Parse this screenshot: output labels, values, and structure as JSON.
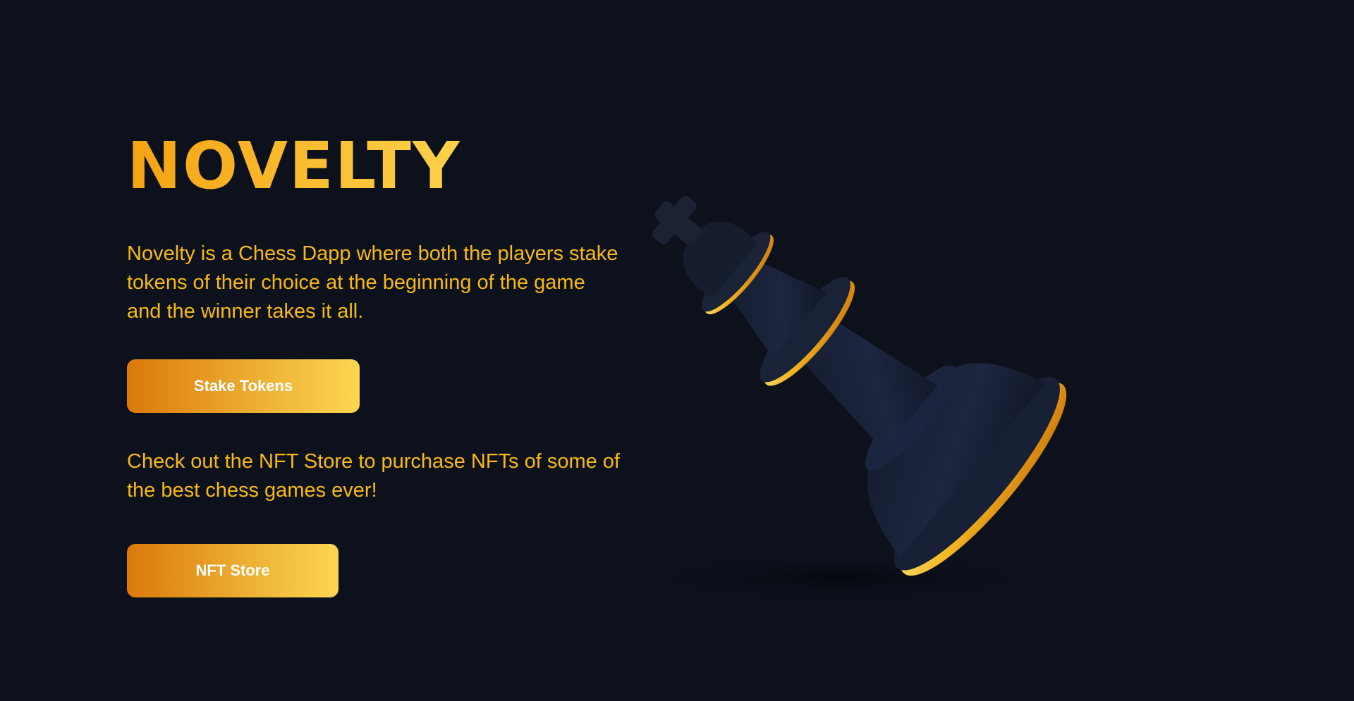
{
  "hero": {
    "title": "NOVELTY",
    "description": "Novelty is a Chess Dapp where both the players stake tokens of their choice at the beginning of the game and the winner takes it all.",
    "stake_button": "Stake Tokens",
    "nft_description": "Check out the NFT Store to purchase NFTs of some of the best chess games ever!",
    "nft_button": "NFT Store"
  },
  "colors": {
    "background": "#0d111c",
    "accent": "#f7b917",
    "button_start": "#db790b",
    "button_end": "#fcd651"
  }
}
